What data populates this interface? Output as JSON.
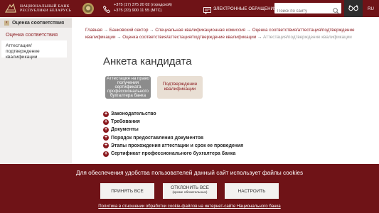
{
  "header": {
    "logo_line1": "НАЦИОНАЛЬНЫЙ БАНК",
    "logo_line2": "РЕСПУБЛИКИ БЕЛАРУСЬ",
    "phone1": "+375 (17) 375 20 02 (городской)",
    "phone2": "+375 (33) 900 11 55 (МТС)",
    "appeals_label": "ЭЛЕКТРОННЫЕ ОБРАЩЕНИЯ",
    "search_placeholder": "Поиск по сайту",
    "lang": "RU",
    "icons": [
      "logo-icon",
      "emblem-icon",
      "phone-icon",
      "appeal-icon",
      "search-icon",
      "accessibility-eye-icon"
    ]
  },
  "sidebar": {
    "section_title": "Оценка соответствия",
    "link": "Оценка соответствия",
    "active_item": "Аттестация/подтверждение квалификации"
  },
  "breadcrumb": {
    "items": [
      "Главная",
      "Банковский сектор",
      "Специальная квалификационная комиссия",
      "Оценка соответствия/аттестация/подтверждение квалификации",
      "Оценка соответствия/аттестация/подтверждение квалификации"
    ],
    "current": "Аттестация/подтверждение квалификации",
    "separator": "→"
  },
  "main": {
    "title": "Анкета кандидата",
    "cards": [
      {
        "label": "Аттестация на право получения сертификата профессионального бухгалтера банка"
      },
      {
        "label": "Подтверждение квалификации"
      }
    ],
    "accordion": [
      {
        "label": "Законодательство"
      },
      {
        "label": "Требования"
      },
      {
        "label": "Документы"
      },
      {
        "label": "Порядок предоставления документов"
      },
      {
        "label": "Этапы прохождения аттестации и срок ее проведения"
      },
      {
        "label": "Сертификат профессионального бухгалтера банка"
      }
    ]
  },
  "cookie": {
    "text": "Для обеспечения удобства пользователей данный сайт использует файлы cookies",
    "accept": "ПРИНЯТЬ ВСЕ",
    "decline": "ОТКЛОНИТЬ ВСЕ",
    "decline_sub": "(кроме обязательных)",
    "settings": "НАСТРОИТЬ",
    "policy_link": "Политика в отношении обработки cookie-файлов на интернет-сайте Национального банка"
  },
  "colors": {
    "brand": "#6f1317",
    "accent": "#8b1a1f",
    "sidebar_bg": "#f2f0ef",
    "card_gray": "#8c8c8c",
    "card_beige": "#e9dfd4"
  }
}
